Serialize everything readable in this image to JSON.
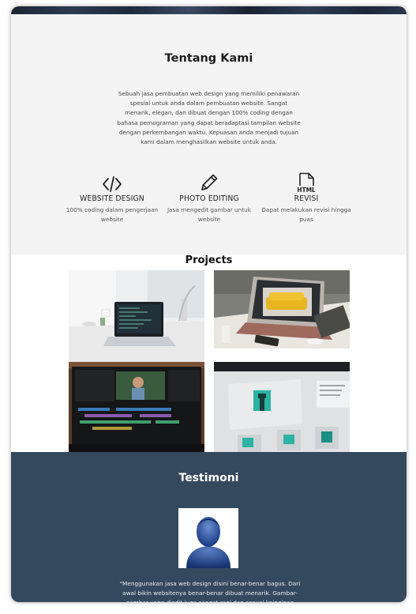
{
  "about": {
    "title": "Tentang Kami",
    "description": "Sebuah jasa pembuatan web design yang memiliki penawaran spesial untuk anda dalam pembuatan website. Sangat menarik, elegan, dan dibuat dengan 100% coding dengan bahasa pemograman yang dapat beradaptasi tampilan website dengan perkembangan waktu. Kepuasan anda menjadi tujuan kami dalam menghasilkan website untuk anda.",
    "features": [
      {
        "icon": "code-icon",
        "title": "WEBSITE DESIGN",
        "desc": "100% coding dalam pengerjaan website"
      },
      {
        "icon": "pencil-icon",
        "title": "PHOTO EDITING",
        "desc": "Jasa mengedit gambar untuk website"
      },
      {
        "icon": "html-file-icon",
        "icon_label": "HTML",
        "title": "REVISI",
        "desc": "Dapat melakukan revisi hingga puas"
      }
    ]
  },
  "projects": {
    "title": "Projects",
    "images": [
      "laptop-desk-photo",
      "laptop-yellow-sofa-photo",
      "video-editing-monitor-photo",
      "website-mockup-photo"
    ]
  },
  "testimoni": {
    "title": "Testimoni",
    "avatar": "user-avatar-icon",
    "quote": "\"Menggunakan jasa web design disini benar-benar bagus. Dari awal bikin websitenya benar-benar dibuat menarik. Gambar-gambar yang diedit juga sangat rapi dan sesuai keinginan saya.\""
  },
  "colors": {
    "testimoni_bg": "#35495e",
    "about_bg": "#f4f4f4",
    "accent_teal": "#2bb3a3"
  }
}
